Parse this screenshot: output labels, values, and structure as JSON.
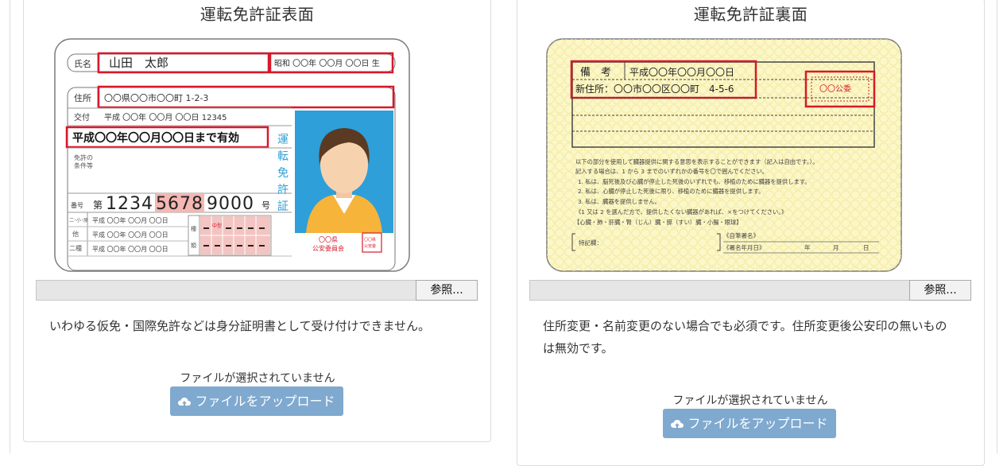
{
  "front": {
    "title": "運転免許証表面",
    "browse_label": "参照...",
    "note": "いわゆる仮免・国際免許などは身分証明書として受け付けできません。",
    "no_file_text": "ファイルが選択されていません",
    "upload_label": "ファイルをアップロード",
    "card": {
      "name_label": "氏名",
      "name_value": "山田　太郎",
      "birth": "昭和 〇〇年 〇〇月 〇〇日 生",
      "address_label": "住所",
      "address_value": "〇〇県〇〇市〇〇町 1-2-3",
      "issue_label": "交付",
      "issue_value": "平成 〇〇年 〇〇月 〇〇日 12345",
      "expiry": "平成〇〇年〇〇月〇〇日まで有効",
      "conditions_label_1": "免許の",
      "conditions_label_2": "条件等",
      "number_label": "番号",
      "number_prefix": "第",
      "number_value_a": "1234",
      "number_value_b": "5678",
      "number_value_c": "9000",
      "number_suffix": "号",
      "row_label_1": "二･小･原",
      "row_label_2": "他",
      "row_label_3": "二種",
      "row_date": "平成 〇〇年 〇〇月 〇〇日",
      "vertical_title": "運転免許証",
      "type_label_1": "種",
      "type_label_2": "類",
      "type_cell_top": "中型",
      "issuer_1": "〇〇県",
      "issuer_2": "公安委員会",
      "seal": "〇〇県公安委員会"
    }
  },
  "back": {
    "title": "運転免許証裏面",
    "browse_label": "参照...",
    "note": "住所変更・名前変更のない場合でも必須です。住所変更後公安印の無いものは無効です。",
    "no_file_text": "ファイルが選択されていません",
    "upload_label": "ファイルをアップロード",
    "card": {
      "remarks_label": "備　考",
      "remarks_date": "平成〇〇年〇〇月〇〇日",
      "new_address": "新住所：〇〇市〇〇区〇〇町　4-5-6",
      "seal": "〇〇公委",
      "donor_lines": [
        "以下の部分を使用して臓器提供に関する意思を表示することができます（記入は自由です。）。",
        "記入する場合は、1 から 3 までのいずれかの番号を〇で囲んでください。",
        "1. 私は、脳死後及び心臓が停止した死後のいずれでも、移植のために臓器を提供します。",
        "2. 私は、心臓が停止した死後に限り、移植のために臓器を提供します。",
        "3. 私は、臓器を提供しません。",
        "《1 又は 2 を選んだ方で、提供したくない臓器があれば、×をつけてください。》",
        "【心臓・肺・肝臓・腎（じん）臓・膵（すい）臓・小腸・眼球】"
      ],
      "special_label": "特記欄：",
      "sign_label": "《自筆署名》",
      "date_label": "《署名年月日》",
      "year": "年",
      "month": "月",
      "day": "日"
    }
  },
  "colors": {
    "accent_red": "#d7192a",
    "card_blue": "#2e9fd8",
    "upload_button": "#7fa9cf",
    "back_card_yellow": "#fbf7c8"
  }
}
